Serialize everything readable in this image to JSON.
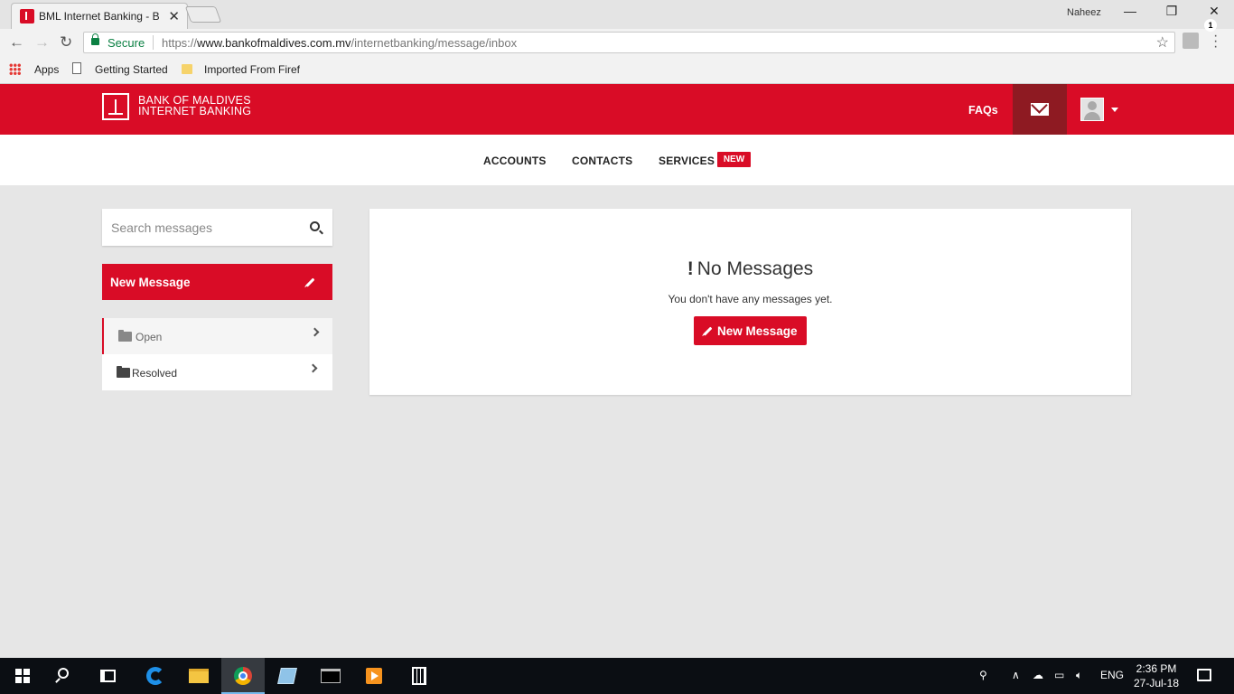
{
  "browser": {
    "tab_title": "BML Internet Banking - B",
    "profile_name": "Naheez",
    "secure_label": "Secure",
    "url_prefix": "https://",
    "url_host": "www.bankofmaldives.com.mv",
    "url_path": "/internetbanking/message/inbox",
    "bookmarks": [
      "Apps",
      "Getting Started",
      "Imported From Firef"
    ]
  },
  "header": {
    "brand_line1": "BANK OF MALDIVES",
    "brand_line2": "INTERNET BANKING",
    "faqs_label": "FAQs"
  },
  "nav": {
    "items": [
      "ACCOUNTS",
      "CONTACTS",
      "SERVICES"
    ],
    "new_badge": "NEW"
  },
  "sidebar": {
    "search_placeholder": "Search messages",
    "new_message_label": "New Message",
    "folders": [
      {
        "label": "Open",
        "active": true
      },
      {
        "label": "Resolved",
        "active": false
      }
    ]
  },
  "main": {
    "empty_title": "No Messages",
    "empty_icon": "!",
    "empty_text": "You don't have any messages yet.",
    "new_message_label": "New Message"
  },
  "taskbar": {
    "language": "ENG",
    "time": "2:36 PM",
    "date": "27-Jul-18",
    "notification_count": "1"
  },
  "colors": {
    "brand_red": "#d90c26",
    "mail_active": "#8e1a22",
    "page_bg": "#e6e6e6"
  }
}
